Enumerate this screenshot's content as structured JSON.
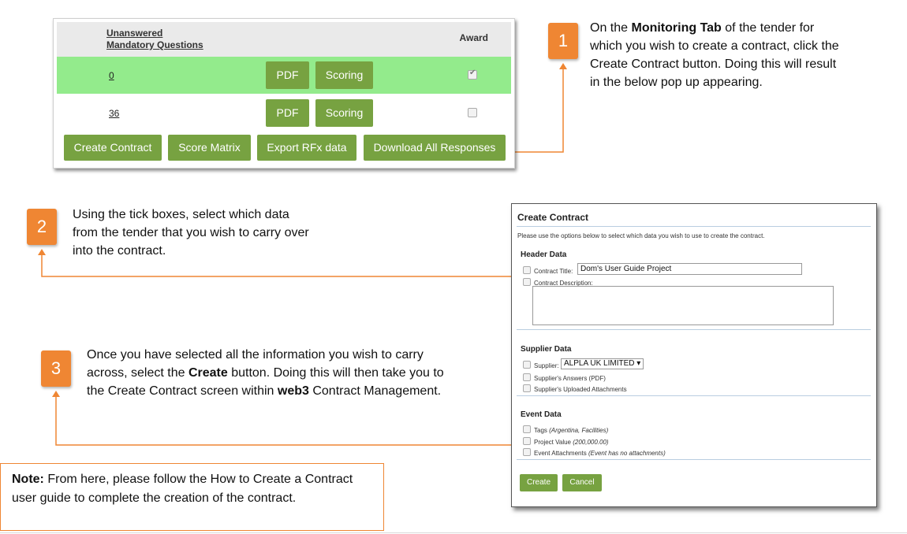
{
  "monitoring_panel": {
    "col_questions_1": "Unanswered",
    "col_questions_2": "Mandatory Questions",
    "col_award": "Award",
    "rows": [
      {
        "count": "0",
        "pdf": "PDF",
        "scoring": "Scoring",
        "award_checked": true
      },
      {
        "count": "36",
        "pdf": "PDF",
        "scoring": "Scoring",
        "award_checked": false
      }
    ],
    "actions": {
      "create_contract": "Create Contract",
      "score_matrix": "Score Matrix",
      "export_rfx": "Export RFx data",
      "download_all": "Download All Responses"
    }
  },
  "callouts": {
    "step1": {
      "number": "1",
      "pre": "On the ",
      "bold": "Monitoring Tab",
      "post": " of the tender for which you wish to create a contract, click the Create Contract button. Doing this will result in the below pop up appearing."
    },
    "step2": {
      "number": "2",
      "text": "Using the tick boxes, select which data from the tender that you wish to carry over into the contract."
    },
    "step3": {
      "number": "3",
      "pre": "Once you have selected all the information you wish to carry across, select the ",
      "bold1": "Create",
      "mid": " button. Doing this will then take you to the Create Contract screen within ",
      "bold2": "web3",
      "post": " Contract Management."
    }
  },
  "popup": {
    "title": "Create Contract",
    "intro": "Please use the options below to select which data you wish to use to create the contract.",
    "header_data": "Header Data",
    "contract_title_label": "Contract Title:",
    "contract_title_value": "Dom's User Guide Project",
    "contract_description_label": "Contract Description:",
    "supplier_data": "Supplier Data",
    "supplier_label": "Supplier:",
    "supplier_value": "ALPLA UK LIMITED",
    "supplier_answers": "Supplier's Answers (PDF)",
    "supplier_attachments": "Supplier's Uploaded Attachments",
    "event_data": "Event Data",
    "tags_label": "Tags ",
    "tags_value": "(Argentina, Facilities)",
    "project_value_label": "Project Value ",
    "project_value_value": "(200,000.00)",
    "event_attachments_label": "Event Attachments ",
    "event_attachments_value": "(Event has no attachments)",
    "create_button": "Create",
    "cancel_button": "Cancel"
  },
  "note": {
    "bold": "Note:",
    "text": " From here, please follow the How to Create a Contract user guide to complete the creation of the contract."
  },
  "colors": {
    "accent_orange": "#ef8633",
    "button_green": "#77a241",
    "row_green": "#93eb8c"
  }
}
